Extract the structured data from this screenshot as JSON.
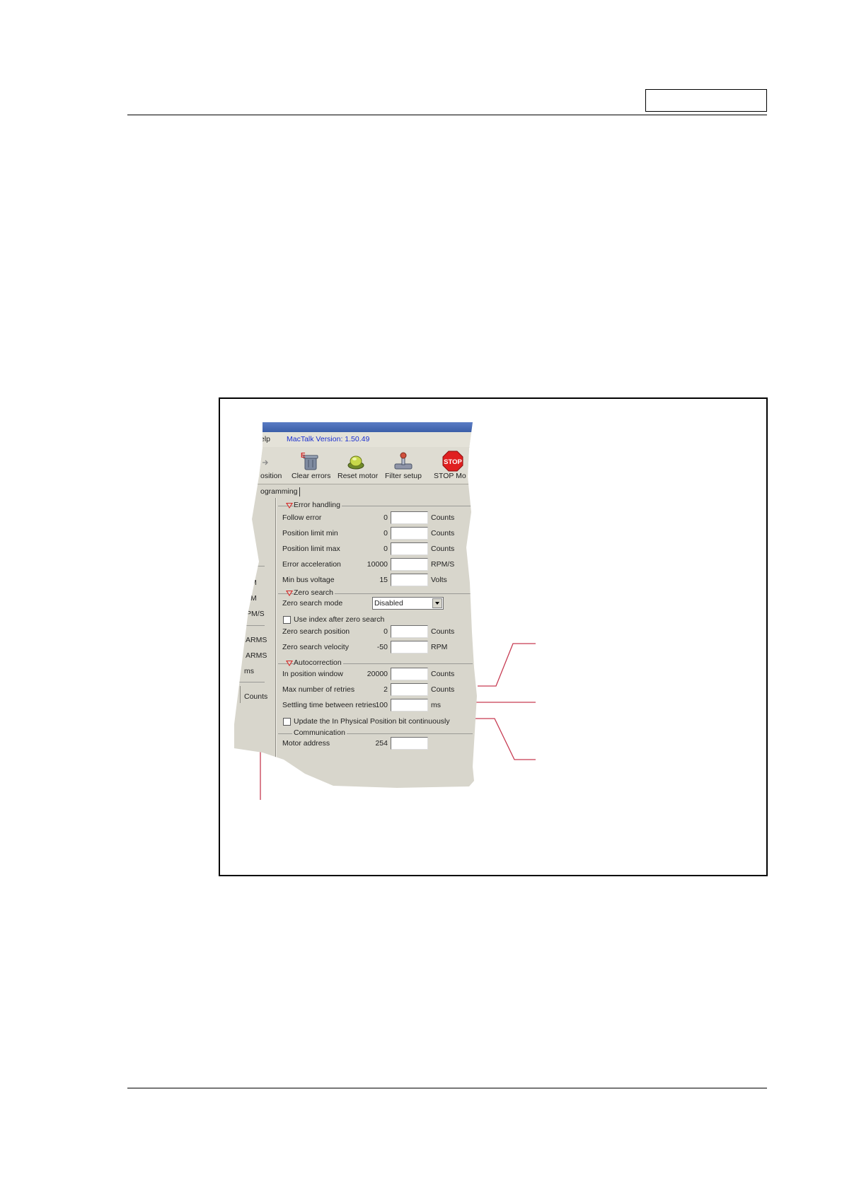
{
  "window": {
    "menu_fragment": "elp",
    "version": "MacTalk Version: 1.50.49"
  },
  "toolbar": [
    {
      "label": "osition",
      "icon": "position-icon"
    },
    {
      "label": "Clear errors",
      "icon": "clear-errors-icon"
    },
    {
      "label": "Reset motor",
      "icon": "reset-motor-icon"
    },
    {
      "label": "Filter setup",
      "icon": "filter-setup-icon"
    },
    {
      "label": "STOP Mo",
      "icon": "stop-sign-icon",
      "icon_text": "STOP"
    }
  ],
  "tab": "ogramming",
  "left_units": [
    "M",
    "M",
    "PM/S",
    "ARMS",
    "ARMS",
    "ms",
    "Counts"
  ],
  "error_handling": {
    "title": "Error handling",
    "rows": [
      {
        "label": "Follow error",
        "value": "0",
        "unit": "Counts"
      },
      {
        "label": "Position limit min",
        "value": "0",
        "unit": "Counts"
      },
      {
        "label": "Position limit max",
        "value": "0",
        "unit": "Counts"
      },
      {
        "label": "Error acceleration",
        "value": "10000",
        "unit": "RPM/S"
      },
      {
        "label": "Min bus voltage",
        "value": "15",
        "unit": "Volts"
      }
    ]
  },
  "zero_search": {
    "title": "Zero search",
    "mode_label": "Zero search mode",
    "mode_value": "Disabled",
    "use_index_label": "Use index after zero search",
    "rows": [
      {
        "label": "Zero search position",
        "value": "0",
        "unit": "Counts"
      },
      {
        "label": "Zero search velocity",
        "value": "-50",
        "unit": "RPM"
      }
    ]
  },
  "autocorrection": {
    "title": "Autocorrection",
    "rows": [
      {
        "label": "In position window",
        "value": "20000",
        "unit": "Counts"
      },
      {
        "label": "Max number of retries",
        "value": "2",
        "unit": "Counts"
      },
      {
        "label": "Settling time between retries",
        "value": "100",
        "unit": "ms"
      }
    ]
  },
  "update_checkbox_label": "Update the In Physical Position bit continuously",
  "communication": {
    "title": "Communication",
    "rows": [
      {
        "label": "Motor address",
        "value": "254"
      }
    ]
  },
  "colors": {
    "title_bar": "#4a6db8",
    "dialog_bg": "#d8d6cc",
    "version_text": "#1a2fd0",
    "callout_lines": "#c73b52",
    "warning_triangle": "#d42a2a"
  }
}
